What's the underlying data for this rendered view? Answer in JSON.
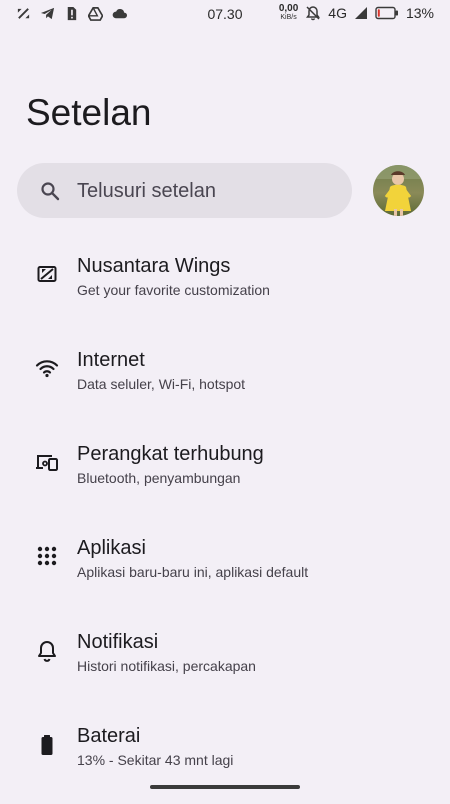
{
  "status_bar": {
    "time": "07.30",
    "net_speed_value": "0,00",
    "net_speed_unit": "KiB/s",
    "network_type": "4G",
    "battery_percent": "13%",
    "battery_level": 0.13,
    "left_icons": [
      "shuffle-icon",
      "telegram-icon",
      "sim-alert-icon",
      "drive-icon",
      "cloud-icon"
    ]
  },
  "page": {
    "title": "Setelan"
  },
  "search": {
    "placeholder": "Telusuri setelan"
  },
  "settings": [
    {
      "icon": "nusantara-wings-icon",
      "title": "Nusantara Wings",
      "subtitle": "Get your favorite customization"
    },
    {
      "icon": "wifi-icon",
      "title": "Internet",
      "subtitle": "Data seluler, Wi-Fi, hotspot"
    },
    {
      "icon": "connected-devices-icon",
      "title": "Perangkat terhubung",
      "subtitle": "Bluetooth, penyambungan"
    },
    {
      "icon": "apps-grid-icon",
      "title": "Aplikasi",
      "subtitle": "Aplikasi baru-baru ini, aplikasi default"
    },
    {
      "icon": "bell-icon",
      "title": "Notifikasi",
      "subtitle": "Histori notifikasi, percakapan"
    },
    {
      "icon": "battery-icon",
      "title": "Baterai",
      "subtitle": "13% - Sekitar 43 mnt lagi"
    }
  ],
  "colors": {
    "background": "#f3eff6",
    "search_background": "#e3dfe6",
    "battery_low": "#d9352b"
  }
}
